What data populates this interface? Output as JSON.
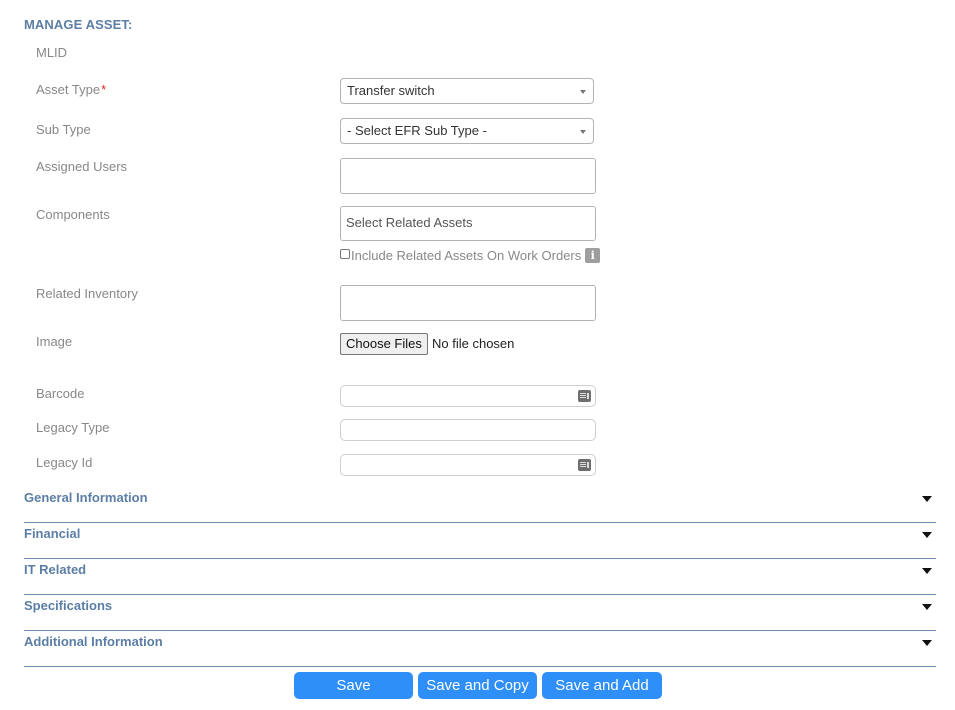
{
  "header": {
    "title": "MANAGE ASSET:"
  },
  "form": {
    "mlid_label": "MLID",
    "asset_type": {
      "label": "Asset Type",
      "required_mark": "*",
      "value": "Transfer switch"
    },
    "sub_type": {
      "label": "Sub Type",
      "value": "- Select EFR Sub Type -"
    },
    "assigned_users": {
      "label": "Assigned Users",
      "value": ""
    },
    "components": {
      "label": "Components",
      "placeholder": "Select Related Assets",
      "checkbox_label": "Include Related Assets On Work Orders",
      "checked": false,
      "info_glyph": "i"
    },
    "related_inventory": {
      "label": "Related Inventory",
      "value": ""
    },
    "image": {
      "label": "Image",
      "button_label": "Choose Files",
      "status": "No file chosen"
    },
    "barcode": {
      "label": "Barcode",
      "value": "",
      "icon": "barcode-scan-icon"
    },
    "legacy_type": {
      "label": "Legacy Type",
      "value": ""
    },
    "legacy_id": {
      "label": "Legacy Id",
      "value": "",
      "icon": "barcode-scan-icon"
    }
  },
  "sections": [
    {
      "label": "General Information",
      "expanded": false
    },
    {
      "label": "Financial",
      "expanded": false
    },
    {
      "label": "IT Related",
      "expanded": false
    },
    {
      "label": "Specifications",
      "expanded": false
    },
    {
      "label": "Additional Information",
      "expanded": false
    }
  ],
  "actions": {
    "save": "Save",
    "save_copy": "Save and Copy",
    "save_add": "Save and Add"
  },
  "colors": {
    "section_heading": "#5b7ea6",
    "divider": "#6f8db3",
    "primary_button": "#2d8ff7",
    "required": "#e02424",
    "label": "#888888"
  }
}
